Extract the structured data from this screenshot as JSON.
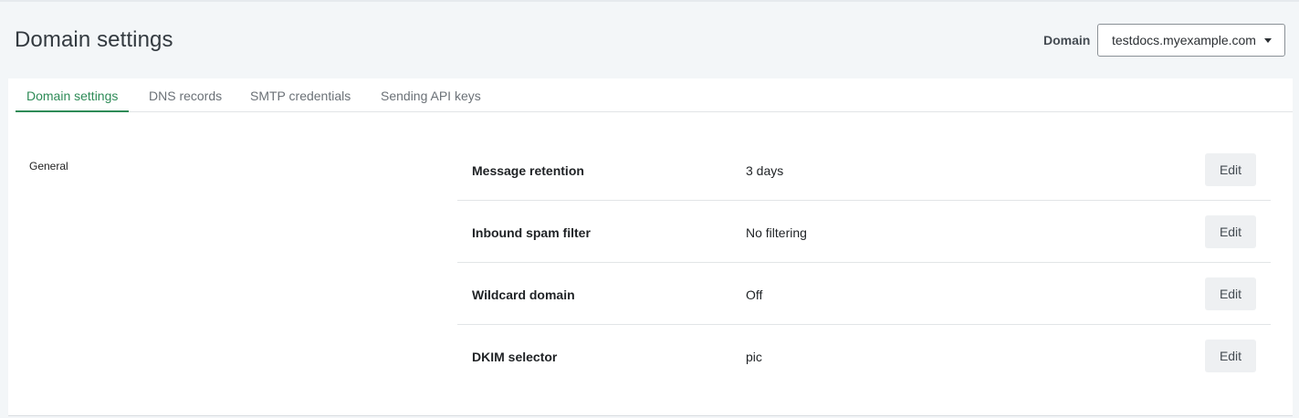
{
  "header": {
    "title": "Domain settings",
    "domain_label": "Domain",
    "domain_selected": "testdocs.myexample.com",
    "caret_icon": "caret-down-icon"
  },
  "tabs": [
    {
      "label": "Domain settings",
      "active": true
    },
    {
      "label": "DNS records",
      "active": false
    },
    {
      "label": "SMTP credentials",
      "active": false
    },
    {
      "label": "Sending API keys",
      "active": false
    }
  ],
  "section": {
    "label": "General"
  },
  "settings": [
    {
      "label": "Message retention",
      "value": "3 days",
      "action": "Edit"
    },
    {
      "label": "Inbound spam filter",
      "value": "No filtering",
      "action": "Edit"
    },
    {
      "label": "Wildcard domain",
      "value": "Off",
      "action": "Edit"
    },
    {
      "label": "DKIM selector",
      "value": "pic",
      "action": "Edit"
    }
  ],
  "colors": {
    "accent": "#2e8b57",
    "page_background": "#f3f6f8",
    "button_background": "#eef0f2"
  }
}
